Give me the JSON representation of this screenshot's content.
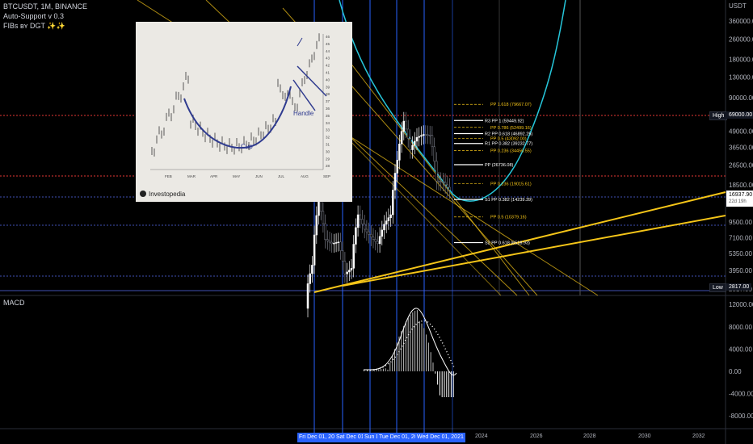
{
  "header": {
    "symbol_line": "BTCUSDT, 1M, BINANCE",
    "indicator1": "Auto-Support v 0.3",
    "indicator2": "FIBs ʙʏ DGT ✨✨"
  },
  "price_axis": {
    "currency": "USDT",
    "labels": [
      "360000.00",
      "260000.00",
      "180000.00",
      "130000.00",
      "90000.00",
      "65000.00",
      "49000.00",
      "36500.00",
      "26500.00",
      "18500.00",
      "13500.00",
      "9500.00",
      "7100.00",
      "5350.00",
      "3950.00",
      "2817.00"
    ],
    "high_label": "High",
    "high_value": "69000.00",
    "current_price": "16937.90",
    "countdown": "22d 19h",
    "low_label": "Low",
    "low_value": "2817.00"
  },
  "macd": {
    "title": "MACD",
    "axis_labels": [
      "12000.00",
      "8000.00",
      "4000.00",
      "0.00",
      "-4000.00",
      "-8000.00"
    ]
  },
  "pivots": [
    {
      "label": "PP 1.618 (79667.07)",
      "color": "#f5c518"
    },
    {
      "label": "R3 PP 1 (59449.92)",
      "color": "#ffffff"
    },
    {
      "label": "PP 0.786 (52499.16)",
      "color": "#f5c518"
    },
    {
      "label": "R2 PP 0.618 (46892.25)",
      "color": "#ffffff"
    },
    {
      "label": "PP 0.5 (43092.00)",
      "color": "#f5c518"
    },
    {
      "label": "R1 PP 0.382 (39232.77)",
      "color": "#ffffff"
    },
    {
      "label": "PP 0.236 (34456.55)",
      "color": "#f5c518"
    },
    {
      "label": "PP (26736.08)",
      "color": "#ffffff"
    },
    {
      "label": "PP 0.236 (19015.61)",
      "color": "#f5c518"
    },
    {
      "label": "S1 PP 0.382 (14239.39)",
      "color": "#ffffff"
    },
    {
      "label": "PP 0.5 (10379.16)",
      "color": "#f5c518"
    },
    {
      "label": "S2 PP 0.618 (6518.93)",
      "color": "#ffffff"
    }
  ],
  "time_axis": {
    "highlighted_dates": [
      "Fri Dec 01, 2017",
      "Sat Dec 01, 2018",
      "Sun Dec 01, 2019",
      "Tue Dec 01, 2020",
      "Wed Dec 01, 2021"
    ],
    "years": [
      "2024",
      "2026",
      "2028",
      "2030",
      "2032"
    ]
  },
  "inset": {
    "brand": "Investopedia",
    "cup_label": "Cup",
    "handle_label": "Handle",
    "months": [
      "FEB",
      "MAR",
      "APR",
      "MAY",
      "JUN",
      "JUL",
      "AUG",
      "SEP"
    ],
    "scale": [
      "46",
      "45",
      "44",
      "43",
      "42",
      "41",
      "40",
      "39",
      "38",
      "37",
      "36",
      "35",
      "34",
      "33",
      "32",
      "31",
      "30",
      "29",
      "28"
    ]
  },
  "chart_data": {
    "type": "candlestick",
    "title": "BTCUSDT, 1M, BINANCE",
    "price_scale": "log",
    "y_range_usdt": [
      2817,
      360000
    ],
    "monthly_close_approx": {
      "x": [
        "2017-06",
        "2017-09",
        "2017-12",
        "2018-03",
        "2018-06",
        "2018-09",
        "2018-12",
        "2019-03",
        "2019-06",
        "2019-09",
        "2019-12",
        "2020-03",
        "2020-06",
        "2020-09",
        "2020-12",
        "2021-03",
        "2021-06",
        "2021-09",
        "2021-12",
        "2022-03",
        "2022-06",
        "2022-09",
        "2022-11"
      ],
      "y": [
        2480,
        4340,
        13800,
        6900,
        6400,
        6600,
        3700,
        4100,
        10800,
        8300,
        7200,
        6400,
        9100,
        10800,
        29000,
        58800,
        35000,
        43800,
        46200,
        45500,
        19900,
        19400,
        16937
      ]
    },
    "macd_histogram_peak": 11000,
    "macd_histogram_trough": -4500
  }
}
